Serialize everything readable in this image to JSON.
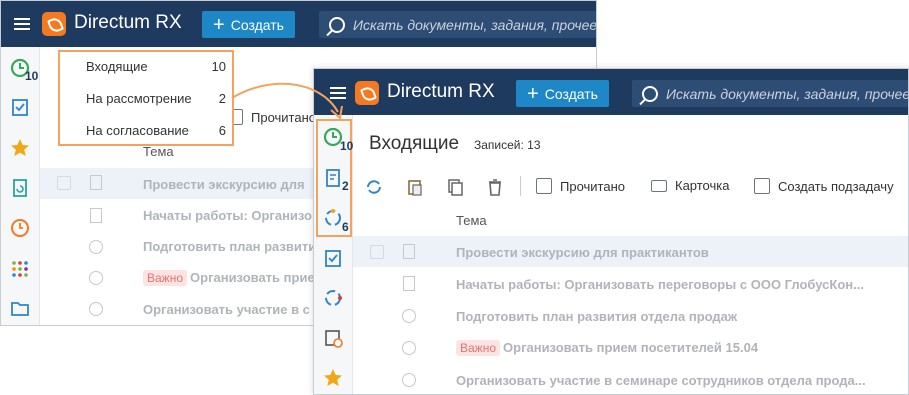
{
  "app": {
    "brand": "Directum RX",
    "create_label": "Создать",
    "search_placeholder": "Искать документы, задания, прочее"
  },
  "popup": {
    "items": [
      {
        "label": "Входящие",
        "count": "10"
      },
      {
        "label": "На рассмотрение",
        "count": "2"
      },
      {
        "label": "На согласование",
        "count": "6"
      }
    ]
  },
  "left_window": {
    "clock_badge": "10",
    "read_label": "Прочитано",
    "subject_header": "Тема",
    "rows": [
      "Провести экскурсию для",
      "Начаты работы: Организо",
      "Подготовить план развити",
      "Организовать прие",
      "Организовать участие в с"
    ],
    "important_label": "Важно"
  },
  "right_window": {
    "page_title": "Входящие",
    "records_label": "Записей: 13",
    "badges": [
      "10",
      "2",
      "6"
    ],
    "toolbar": {
      "read": "Прочитано",
      "card": "Карточка",
      "subtask": "Создать подзадачу"
    },
    "subject_header": "Тема",
    "rows": [
      "Провести экскурсию для практикантов",
      "Начаты работы: Организовать переговоры с ООО ГлобусКон...",
      "Подготовить план развития отдела продаж",
      "Организовать прием посетителей 15.04",
      "Организовать участие в семинаре сотрудников отдела прода..."
    ],
    "important_label": "Важно"
  },
  "colors": {
    "topbar": "#1e3a5f",
    "accent": "#f47920",
    "create": "#1e88c7",
    "highlight": "#f3a35f"
  }
}
